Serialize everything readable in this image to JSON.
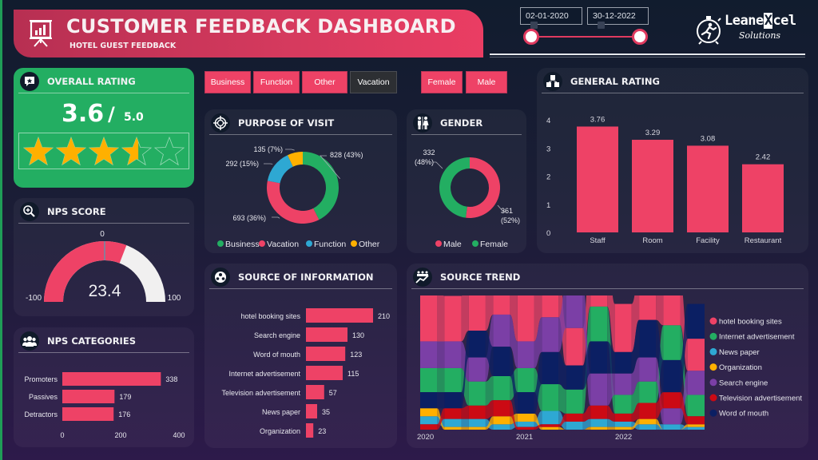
{
  "header": {
    "title": "CUSTOMER FEEDBACK DASHBOARD",
    "subtitle": "HOTEL GUEST FEEDBACK",
    "date_start": "02-01-2020",
    "date_end": "30-12-2022",
    "date_range_slider": {
      "start_fraction": 0.0,
      "end_fraction": 1.0
    },
    "logo_main_left": "Leane",
    "logo_main_x": "X",
    "logo_main_right": "cel",
    "logo_sub": "Solutions",
    "icons": {
      "banner": "presentation-chart-icon",
      "logo": "stopwatch-runner-icon"
    }
  },
  "colors": {
    "accent": "#ee4266",
    "green": "#23ae62",
    "blue": "#2ea8d3",
    "orange": "#ffb000",
    "purple": "#7b3fa6",
    "red": "#cc0a14",
    "navy": "#0b1f63"
  },
  "filters": {
    "purpose": [
      {
        "label": "Business",
        "selected": true
      },
      {
        "label": "Function",
        "selected": true
      },
      {
        "label": "Other",
        "selected": true
      },
      {
        "label": "Vacation",
        "selected": false
      }
    ],
    "gender": [
      {
        "label": "Female",
        "selected": true
      },
      {
        "label": "Male",
        "selected": true
      }
    ]
  },
  "overall_rating": {
    "title": "OVERALL RATING",
    "value": "3.6",
    "slash": "/",
    "max": "5.0",
    "stars_filled": 3.6,
    "stars_total": 5
  },
  "nps_score": {
    "title": "NPS SCORE",
    "value": "23.4",
    "min_label": "-100",
    "max_label": "100",
    "target_label": "0",
    "min": -100,
    "max": 100,
    "current": 23.4,
    "target": 0
  },
  "nps_categories": {
    "title": "NPS CATEGORIES",
    "chart_data": {
      "type": "bar",
      "orientation": "horizontal",
      "categories": [
        "Promoters",
        "Passives",
        "Detractors"
      ],
      "values": [
        338,
        179,
        176
      ],
      "xticks": [
        "0",
        "200",
        "400"
      ],
      "xlim": [
        0,
        400
      ]
    }
  },
  "purpose_of_visit": {
    "title": "PURPOSE OF VISIT",
    "chart_data": {
      "type": "pie",
      "donut": true,
      "slices": [
        {
          "name": "Business",
          "value": 828,
          "label": "828 (43%)",
          "color": "#23ae62"
        },
        {
          "name": "Vacation",
          "value": 693,
          "label": "693 (36%)",
          "color": "#ee4266"
        },
        {
          "name": "Function",
          "value": 292,
          "label": "292 (15%)",
          "color": "#2ea8d3"
        },
        {
          "name": "Other",
          "value": 135,
          "label": "135 (7%)",
          "color": "#ffb000"
        }
      ],
      "legend": [
        "Business",
        "Vacation",
        "Function",
        "Other"
      ],
      "legend_position": "bottom"
    }
  },
  "gender": {
    "title": "GENDER",
    "chart_data": {
      "type": "pie",
      "donut": true,
      "slices": [
        {
          "name": "Male",
          "value": 361,
          "label_value": "361",
          "label_pct": "(52%)",
          "color": "#ee4266"
        },
        {
          "name": "Female",
          "value": 332,
          "label_value": "332",
          "label_pct": "(48%)",
          "color": "#23ae62"
        }
      ],
      "legend": [
        "Male",
        "Female"
      ],
      "legend_position": "bottom"
    }
  },
  "general_rating": {
    "title": "GENERAL RATING",
    "chart_data": {
      "type": "bar",
      "categories": [
        "Staff",
        "Room",
        "Facility",
        "Restaurant"
      ],
      "values": [
        3.76,
        3.29,
        3.08,
        2.42
      ],
      "value_labels": [
        "3.76",
        "3.29",
        "3.08",
        "2.42"
      ],
      "yticks": [
        "0",
        "1",
        "2",
        "3",
        "4"
      ],
      "ylim": [
        0,
        4
      ]
    }
  },
  "source_of_information": {
    "title": "SOURCE OF INFORMATION",
    "chart_data": {
      "type": "bar",
      "orientation": "horizontal",
      "categories": [
        "hotel booking sites",
        "Search engine",
        "Word of mouth",
        "Internet advertisement",
        "Television advertisement",
        "News paper",
        "Organization"
      ],
      "values": [
        210,
        130,
        123,
        115,
        57,
        35,
        23
      ],
      "value_labels": [
        "210",
        "130",
        "123",
        "115",
        "57",
        "35",
        "23"
      ]
    }
  },
  "source_trend": {
    "title": "SOURCE TREND",
    "chart_data": {
      "type": "area",
      "subtype": "ribbon",
      "x_ticks": [
        "2020",
        "2021",
        "2022"
      ],
      "periods": 12,
      "legend_position": "right",
      "series": [
        {
          "name": "hotel booking sites",
          "color": "#ee4266",
          "values": [
            20,
            17,
            21,
            22,
            20,
            22,
            14,
            22,
            18,
            17,
            16,
            12
          ]
        },
        {
          "name": "Internet advertisement",
          "color": "#23ae62",
          "values": [
            9,
            9,
            9,
            9,
            9,
            10,
            9,
            13,
            7,
            8,
            13,
            8
          ]
        },
        {
          "name": "News paper",
          "color": "#2ea8d3",
          "values": [
            3,
            3,
            3,
            2,
            2,
            5,
            3,
            3,
            2,
            2,
            2,
            1
          ]
        },
        {
          "name": "Organization",
          "color": "#ffb000",
          "values": [
            3,
            1,
            1,
            3,
            3,
            1,
            0,
            1,
            1,
            2,
            0,
            1
          ]
        },
        {
          "name": "Search engine",
          "color": "#7b3fa6",
          "values": [
            10,
            10,
            9,
            12,
            10,
            13,
            16,
            12,
            8,
            9,
            6,
            9
          ]
        },
        {
          "name": "Television advertisement",
          "color": "#cc0a14",
          "values": [
            2,
            4,
            5,
            6,
            1,
            1,
            3,
            5,
            3,
            6,
            6,
            3
          ]
        },
        {
          "name": "Word of mouth",
          "color": "#0b1f63",
          "values": [
            6,
            6,
            10,
            11,
            8,
            12,
            9,
            12,
            8,
            14,
            12,
            13
          ]
        }
      ]
    }
  }
}
